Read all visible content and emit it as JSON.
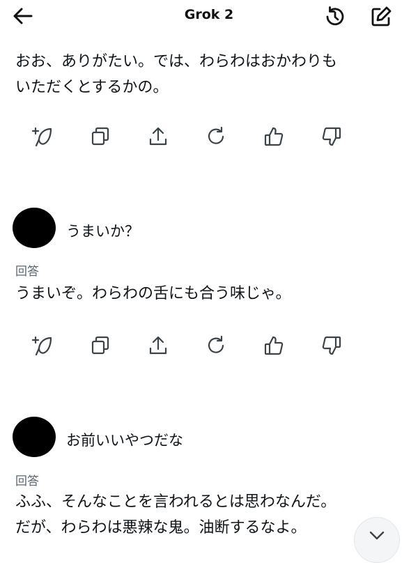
{
  "header": {
    "title": "Grok 2"
  },
  "messages": [
    {
      "text_line1": "おお、ありがたい。では、わらわはおかわりも",
      "text_line2": "いただくとするかの。"
    },
    {
      "user_text": "うまいか？",
      "answer_label": "回答",
      "text": "うまいぞ。わらわの舌にも合う味じゃ。"
    },
    {
      "user_text": "お前いいやつだな",
      "answer_label": "回答",
      "text_line1": "ふふ、そんなことを言われるとは思わなんだ。",
      "text_line2": "だが、わらわは悪辣な鬼。油断するなよ。"
    }
  ],
  "icons": {
    "back": "arrow-left-icon",
    "history": "history-icon",
    "new_chat": "edit-icon",
    "actions": [
      "regenerate-sparkle-icon",
      "copy-icon",
      "share-icon",
      "refresh-icon",
      "thumbs-up-icon",
      "thumbs-down-icon"
    ],
    "scroll": "chevron-down-icon"
  },
  "colors": {
    "text": "#0f1419",
    "muted": "#5b6670",
    "icon": "#3c4348"
  }
}
